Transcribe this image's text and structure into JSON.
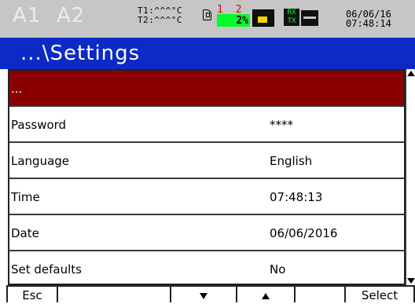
{
  "status": {
    "alarm1": "A1",
    "alarm2": "A2",
    "temp1": "T1:^^^°C",
    "temp2": "T2:^^^°C",
    "channels": "1 2",
    "percent": "2%",
    "rx": "RX",
    "tx": "TX",
    "date": "06/06/16",
    "time": "07:48:14"
  },
  "title": "...\\Settings",
  "rows": [
    {
      "label": "...",
      "value": ""
    },
    {
      "label": "Password",
      "value": "****"
    },
    {
      "label": "Language",
      "value": "English"
    },
    {
      "label": "Time",
      "value": "07:48:13"
    },
    {
      "label": "Date",
      "value": "06/06/2016"
    },
    {
      "label": "Set defaults",
      "value": "No"
    }
  ],
  "softkeys": {
    "esc": "Esc",
    "select": "Select"
  },
  "colors": {
    "title_bg": "#0c2ac6",
    "selected_row_bg": "#8a0000",
    "status_bg": "#c6c6c6",
    "percent_bg": "#00ff2a"
  }
}
